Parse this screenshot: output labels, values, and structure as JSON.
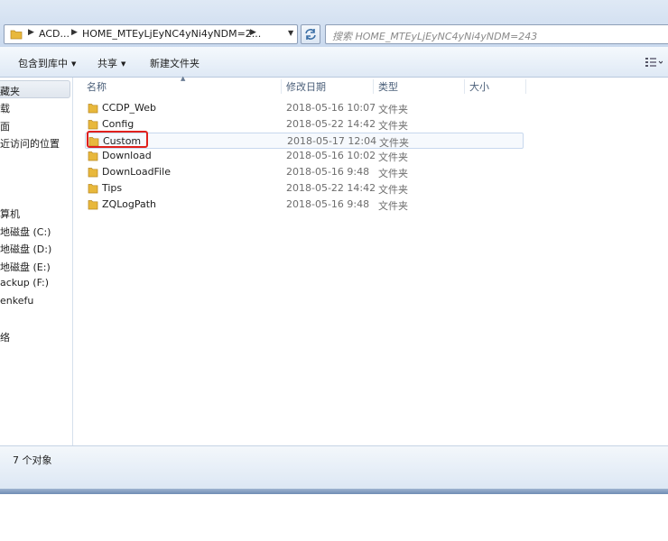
{
  "address": {
    "crumbs": [
      "ACD...",
      "HOME_MTEyLjEyNC4yNi4yNDM=2..."
    ]
  },
  "search": {
    "placeholder": "搜索 HOME_MTEyLjEyNC4yNi4yNDM=243"
  },
  "toolbar": {
    "include_library": "包含到库中",
    "share": "共享",
    "new_folder": "新建文件夹"
  },
  "nav": {
    "items": [
      "藏夹",
      "载",
      "面",
      "近访问的位置",
      "算机",
      "地磁盘 (C:)",
      "地磁盘 (D:)",
      "地磁盘 (E:)",
      "ackup (F:)",
      "enkefu",
      "络"
    ]
  },
  "columns": {
    "name": "名称",
    "date": "修改日期",
    "type": "类型",
    "size": "大小"
  },
  "files": [
    {
      "name": "CCDP_Web",
      "date": "2018-05-16 10:07",
      "type": "文件夹"
    },
    {
      "name": "Config",
      "date": "2018-05-22 14:42",
      "type": "文件夹"
    },
    {
      "name": "Custom",
      "date": "2018-05-17 12:04",
      "type": "文件夹"
    },
    {
      "name": "Download",
      "date": "2018-05-16 10:02",
      "type": "文件夹"
    },
    {
      "name": "DownLoadFile",
      "date": "2018-05-16 9:48",
      "type": "文件夹"
    },
    {
      "name": "Tips",
      "date": "2018-05-22 14:42",
      "type": "文件夹"
    },
    {
      "name": "ZQLogPath",
      "date": "2018-05-16 9:48",
      "type": "文件夹"
    }
  ],
  "status": {
    "count": "7 个对象"
  },
  "colors": {
    "folder": "#e8b83c",
    "highlight_box": "#e0201c",
    "selection_border": "#c8d8ee"
  }
}
